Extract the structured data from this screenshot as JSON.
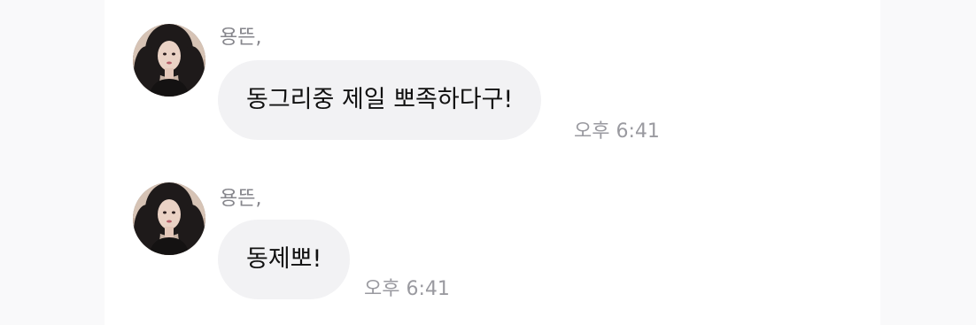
{
  "chat": {
    "messages": [
      {
        "sender": "용뜬,",
        "text": "동그리중 제일 뽀족하다구!",
        "time": "오후 6:41",
        "avatar_icon": "profile-photo"
      },
      {
        "sender": "용뜬,",
        "text": "동제뽀!",
        "time": "오후 6:41",
        "avatar_icon": "profile-photo"
      }
    ]
  },
  "colors": {
    "page_background": "#f9f9fa",
    "panel_background": "#ffffff",
    "bubble_background": "#f2f2f4",
    "sender_text": "#86868c",
    "time_text": "#9a9aa0",
    "message_text": "#111111"
  }
}
